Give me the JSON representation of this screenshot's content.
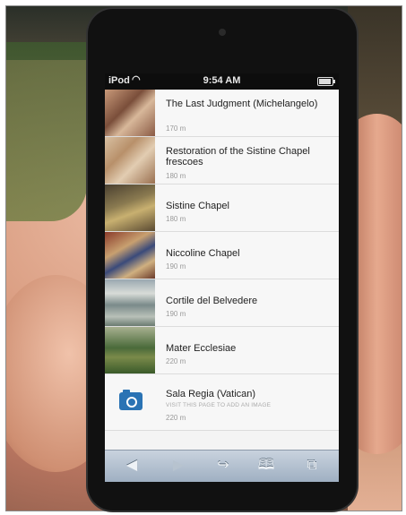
{
  "status_bar": {
    "carrier": "iPod",
    "time": "9:54 AM"
  },
  "places": [
    {
      "title": "The Last Judgment (Michelangelo)",
      "distance": "170 m"
    },
    {
      "title": "Restoration of the Sistine Chapel frescoes",
      "distance": "180 m"
    },
    {
      "title": "Sistine Chapel",
      "distance": "180 m"
    },
    {
      "title": "Niccoline Chapel",
      "distance": "190 m"
    },
    {
      "title": "Cortile del Belvedere",
      "distance": "190 m"
    },
    {
      "title": "Mater Ecclesiae",
      "distance": "220 m"
    },
    {
      "title": "Sala Regia (Vatican)",
      "subtitle": "VISIT THIS PAGE TO ADD AN IMAGE",
      "distance": "220 m"
    }
  ],
  "toolbar": {
    "back_icon": "back-arrow-icon",
    "forward_icon": "forward-arrow-icon",
    "share_icon": "share-icon",
    "bookmarks_icon": "bookmarks-icon",
    "tabs_icon": "tabs-icon"
  },
  "colors": {
    "camera_placeholder": "#2a73b4",
    "toolbar_top": "#c9d3de",
    "toolbar_bottom": "#9fb0c2"
  }
}
